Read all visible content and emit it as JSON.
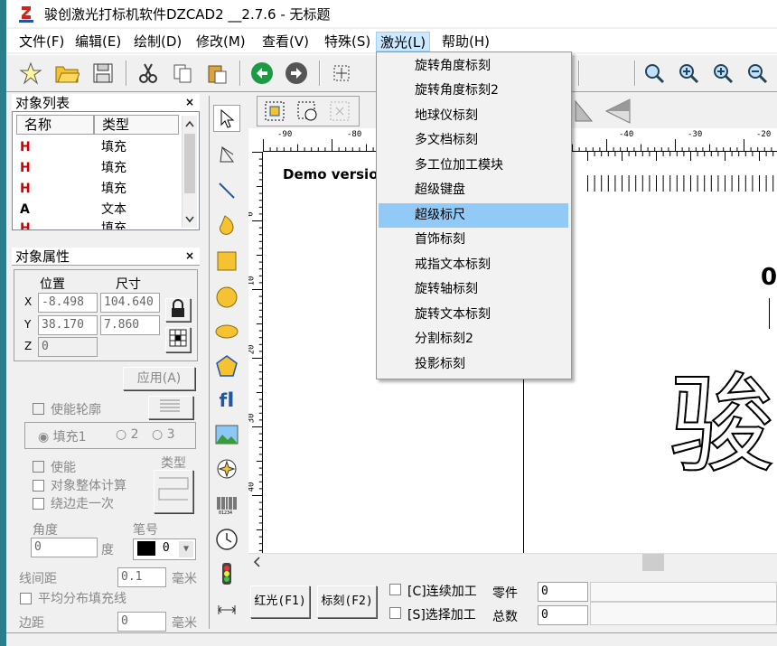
{
  "window": {
    "title": "骏创激光打标机软件DZCAD2 __2.7.6 - 无标题"
  },
  "menubar": {
    "items": [
      {
        "label": "文件(F)"
      },
      {
        "label": "编辑(E)"
      },
      {
        "label": "绘制(D)"
      },
      {
        "label": "修改(M)"
      },
      {
        "label": "查看(V)"
      },
      {
        "label": "特殊(S)"
      },
      {
        "label": "激光(L)"
      },
      {
        "label": "帮助(H)"
      }
    ]
  },
  "laser_menu": {
    "items": [
      {
        "label": "旋转角度标刻"
      },
      {
        "label": "旋转角度标刻2"
      },
      {
        "label": "地球仪标刻"
      },
      {
        "label": "多文档标刻"
      },
      {
        "label": "多工位加工模块"
      },
      {
        "label": "超级键盘"
      },
      {
        "label": "超级标尺"
      },
      {
        "label": "首饰标刻"
      },
      {
        "label": "戒指文本标刻"
      },
      {
        "label": "旋转轴标刻"
      },
      {
        "label": "旋转文本标刻"
      },
      {
        "label": "分割标刻2"
      },
      {
        "label": "投影标刻"
      }
    ],
    "highlighted": "超级标尺"
  },
  "object_list": {
    "title": "对象列表",
    "close": "×",
    "col_name": "名称",
    "col_type": "类型",
    "rows": [
      {
        "icon": "H",
        "type": "填充"
      },
      {
        "icon": "H",
        "type": "填充"
      },
      {
        "icon": "H",
        "type": "填充"
      },
      {
        "icon": "A",
        "type": "文本"
      },
      {
        "icon": "H",
        "type": "填充"
      }
    ]
  },
  "object_props": {
    "title": "对象属性",
    "close": "×",
    "pos_label": "位置",
    "size_label": "尺寸",
    "x_label": "X",
    "y_label": "Y",
    "z_label": "Z",
    "x_pos": "-8.498",
    "y_pos": "38.170",
    "z_pos": "0",
    "x_size": "104.640",
    "y_size": "7.860",
    "apply": "应用(A)"
  },
  "fill": {
    "enable_outline": "使能轮廓",
    "fill1": "填充1",
    "fill2": "2",
    "fill3": "3",
    "enable": "使能",
    "type_label": "类型",
    "whole_calc": "对象整体计算",
    "around_once": "绕边走一次",
    "angle_label": "角度",
    "angle_value": "0",
    "angle_unit": "度",
    "pen_label": "笔号",
    "pen_value": "0",
    "line_spacing_label": "线间距",
    "line_spacing_value": "0.1",
    "line_spacing_unit": "毫米",
    "even_fill": "平均分布填充线",
    "margin_label": "边距",
    "margin_value": "0",
    "margin_unit": "毫米"
  },
  "canvas": {
    "demo_text": "Demo versio",
    "big_char": "骏",
    "side_char": "0",
    "ruler_top": [
      "-90",
      "-80",
      "-40",
      "-30",
      "-20"
    ],
    "ruler_left": [
      "0",
      "10",
      "20",
      "30",
      "40"
    ]
  },
  "bottom": {
    "red_light": "红光(F1)",
    "mark": "标刻(F2)",
    "continuous": "[C]连续加工",
    "select": "[S]选择加工",
    "parts_label": "零件",
    "parts_value": "0",
    "total_label": "总数",
    "total_value": "0"
  }
}
